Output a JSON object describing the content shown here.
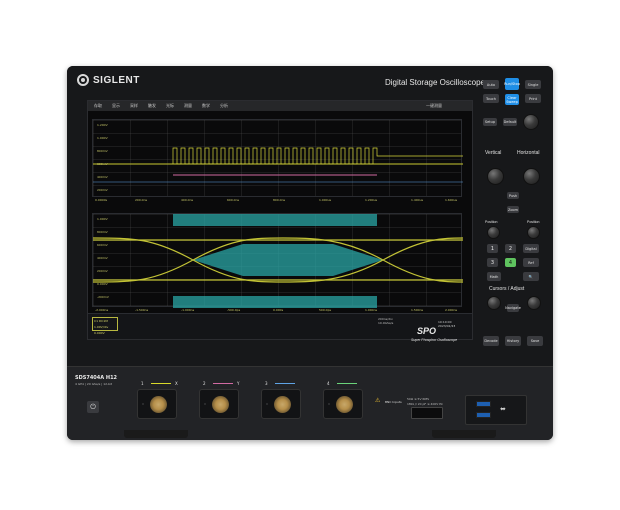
{
  "brand": {
    "name": "SIGLENT",
    "device_title": "Digital Storage Oscilloscope"
  },
  "menu": {
    "items": [
      "存取",
      "显示",
      "采样",
      "触发",
      "光标",
      "测量",
      "数学",
      "分析"
    ],
    "right_label": "一键测量"
  },
  "screen": {
    "top_ylabels": [
      "1.200V",
      "1.000V",
      "800mV",
      "600mV",
      "400mV",
      "200mV"
    ],
    "top_xlabels": [
      "0.0000s",
      "200.0ns",
      "400.0ns",
      "600.0ns",
      "800.0ns",
      "1.000us",
      "1.200us",
      "1.400us",
      "1.600us"
    ],
    "bottom_ylabels": [
      "1.000V",
      "800mV",
      "600mV",
      "400mV",
      "200mV",
      "0.000V",
      "-200mV"
    ],
    "bottom_xlabels": [
      "-2.000ns",
      "-1.500ns",
      "-1.000ns",
      "-500.0ps",
      "0.000s",
      "500.0ps",
      "1.000ns",
      "1.500ns",
      "2.000ns"
    ],
    "channel_card": [
      "C1 DC1M",
      "1.00V/div",
      "0.000V"
    ],
    "info_right": [
      "200ns/div",
      "10.0GSa/s"
    ],
    "time": [
      "10:10:00",
      "2023/02/23"
    ]
  },
  "spo": {
    "title": "SPO",
    "subtitle": "Super Phosphor Oscilloscope"
  },
  "controls": {
    "top_buttons": [
      "Auto",
      "Run/Stop",
      "Single",
      "Clear Sweep"
    ],
    "row2": [
      "Setup",
      "Default",
      "Print",
      "Touch"
    ],
    "vertical": "Vertical",
    "horizontal": "Horizontal",
    "position": "Position",
    "push": "Push",
    "zoom": "Zoom",
    "numbers": [
      "1",
      "2",
      "3",
      "4"
    ],
    "math": "Math",
    "digital": "Digital",
    "ref": "Ref",
    "search": "Search",
    "cursors": "Cursors / Adjust",
    "decode": "Decode",
    "history": "History",
    "navigate": "Navigate",
    "save": "Save"
  },
  "front": {
    "model": "SDS7404A H12",
    "model_sub": "4 GHz | 20 GSa/s | 12-bit",
    "channels": [
      {
        "id": "1",
        "color": "#d9d92a",
        "symbol": "X"
      },
      {
        "id": "2",
        "color": "#d16aa2",
        "symbol": "Y"
      },
      {
        "id": "3",
        "color": "#5fa3e5",
        "symbol": ""
      },
      {
        "id": "4",
        "color": "#6ad37a",
        "symbol": ""
      }
    ],
    "bnc_label": "BNC Inputs",
    "specs": [
      "50Ω ≤ 5V RMS",
      "1MΩ // 20 pF ≤ 400V Pk"
    ]
  }
}
